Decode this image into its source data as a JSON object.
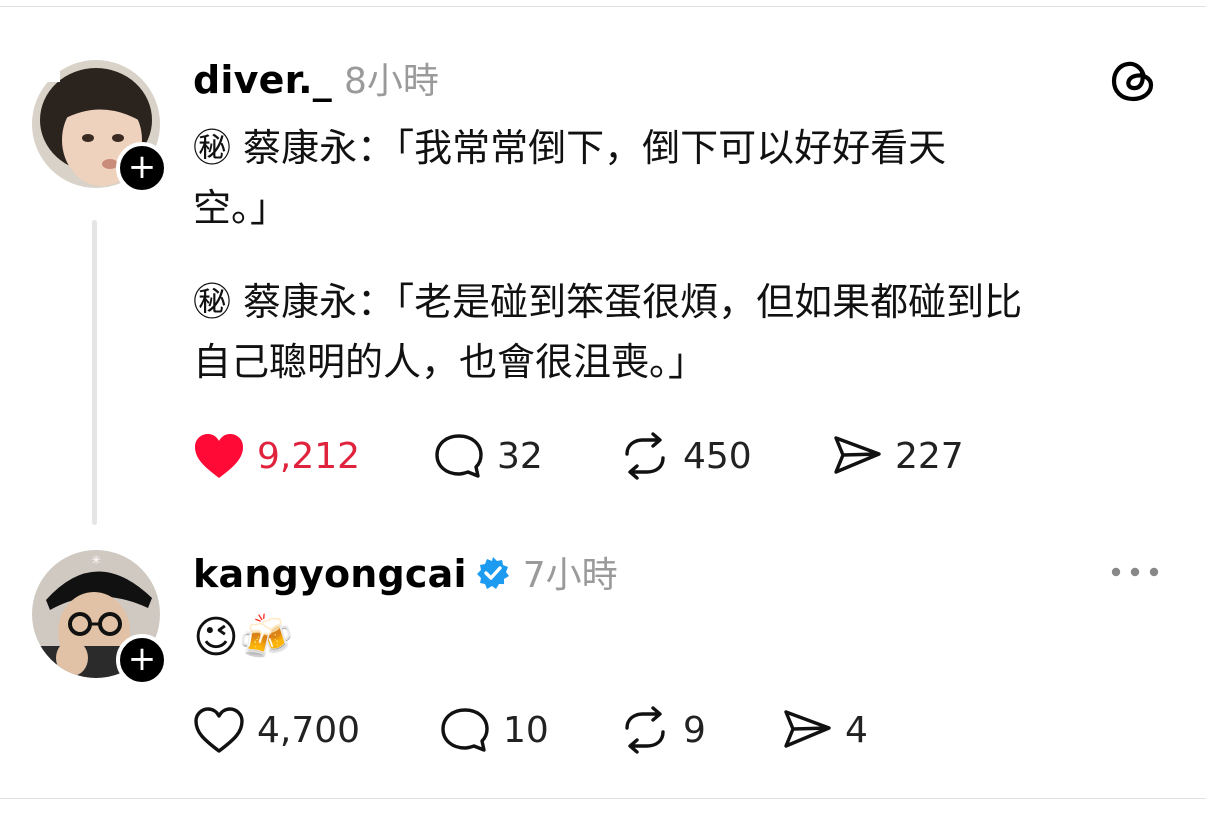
{
  "post1": {
    "username": "diver._",
    "time": "8小時",
    "line1": "㊙ 蔡康永：「我常常倒下，倒下可以好好看天",
    "line2": "空。」",
    "line3": "㊙ 蔡康永：「老是碰到笨蛋很煩，但如果都碰到比",
    "line4": "自己聰明的人，也會很沮喪。」",
    "likes": "9,212",
    "comments": "32",
    "reposts": "450",
    "shares": "227",
    "liked": true
  },
  "post2": {
    "username": "kangyongcai",
    "verified": true,
    "time": "7小時",
    "content": "😉🍻",
    "likes": "4,700",
    "comments": "10",
    "reposts": "9",
    "shares": "4"
  },
  "colors": {
    "like_red": "#e0223d",
    "verified_blue": "#1d9bf0",
    "muted": "#9a9a9a"
  },
  "icons": [
    "threads-logo-icon",
    "follow-plus-icon",
    "heart-icon",
    "comment-icon",
    "repost-icon",
    "share-icon",
    "verified-badge-icon",
    "more-icon"
  ]
}
